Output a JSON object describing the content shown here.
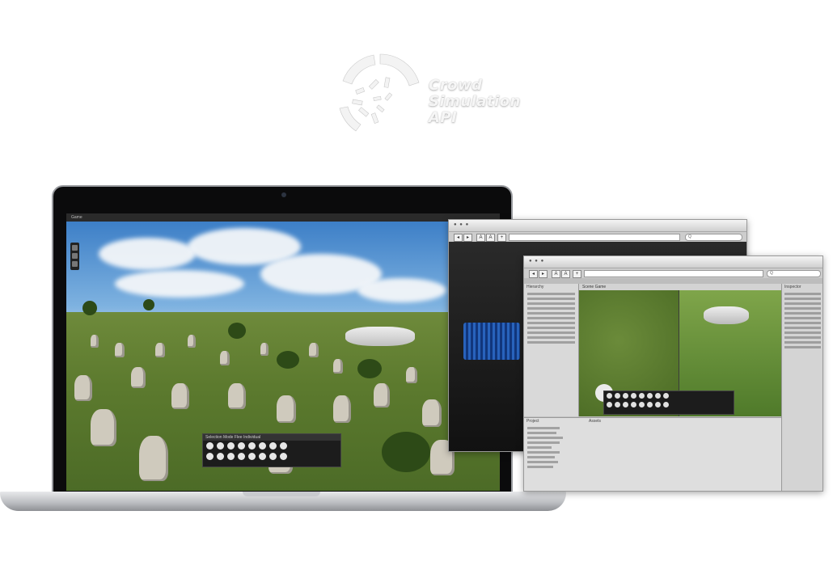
{
  "logo": {
    "line1": "Crowd",
    "line2": "Simulation",
    "line3": "API"
  },
  "laptop": {
    "game_window_title": "Game",
    "tool_panel_tabs": "Selection Mode   Flee   Individual"
  },
  "editor_back": {
    "search_glyph": "Q"
  },
  "editor_front": {
    "search_glyph": "Q",
    "hierarchy_label": "Hierarchy",
    "scene_tab": "Scene",
    "game_tab": "Game",
    "project_tab": "Project",
    "inspector_label": "Inspector",
    "assets_label": "Assets"
  },
  "colors": {
    "logo_text": "#f6f6f6",
    "sky_top": "#3d7fc7",
    "grass": "#5c7a2e",
    "editor_bg": "#c2c2c2",
    "scene_bg": "#242424",
    "crowd_blue": "#2a6fd8"
  }
}
